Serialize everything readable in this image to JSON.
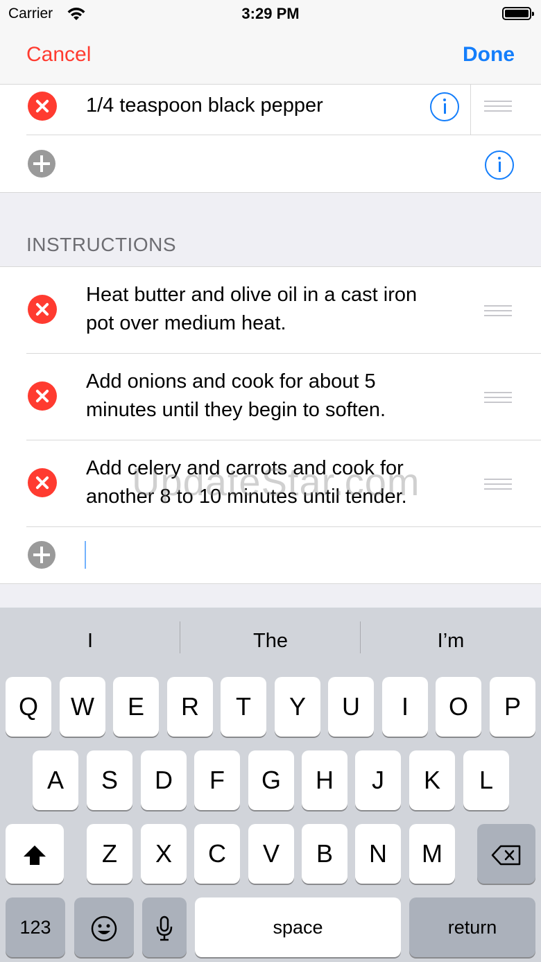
{
  "status_bar": {
    "carrier": "Carrier",
    "time": "3:29 PM"
  },
  "nav": {
    "cancel": "Cancel",
    "done": "Done"
  },
  "ingredients": {
    "last_item": "1/4 teaspoon black pepper"
  },
  "instructions": {
    "header": "INSTRUCTIONS",
    "steps": [
      {
        "line1": "Heat butter and olive oil in a cast iron",
        "line2": "pot over medium heat."
      },
      {
        "line1": "Add onions and cook for about 5",
        "line2": "minutes until they begin to soften."
      },
      {
        "line1": "Add celery and carrots and cook for",
        "line2": "another 8 to 10 minutes until tender."
      }
    ]
  },
  "watermark": "UpdateStar.com",
  "keyboard": {
    "suggestions": [
      "I",
      "The",
      "I’m"
    ],
    "row1": [
      "Q",
      "W",
      "E",
      "R",
      "T",
      "Y",
      "U",
      "I",
      "O",
      "P"
    ],
    "row2": [
      "A",
      "S",
      "D",
      "F",
      "G",
      "H",
      "J",
      "K",
      "L"
    ],
    "row3": [
      "Z",
      "X",
      "C",
      "V",
      "B",
      "N",
      "M"
    ],
    "numbers_key": "123",
    "space_key": "space",
    "return_key": "return"
  }
}
